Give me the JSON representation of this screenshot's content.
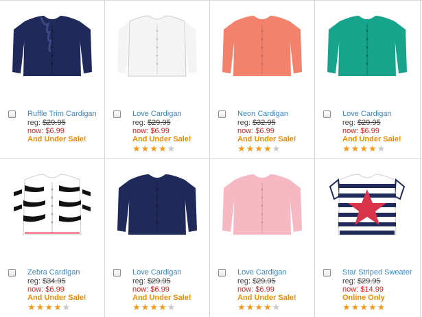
{
  "products": [
    {
      "name": "Ruffle Trim Cardigan",
      "reg_label": "reg:",
      "reg_price": "$29.95",
      "now_label": "now:",
      "now_price": "$6.99",
      "promo": "And Under Sale!",
      "rating": 0,
      "color": "#1f2a5a",
      "style": "ruffle"
    },
    {
      "name": "Love Cardigan",
      "reg_label": "reg:",
      "reg_price": "$29.95",
      "now_label": "now:",
      "now_price": "$6.99",
      "promo": "And Under Sale!",
      "rating": 4,
      "color": "#f4f4f4",
      "style": "plain"
    },
    {
      "name": "Neon Cardigan",
      "reg_label": "reg:",
      "reg_price": "$32.95",
      "now_label": "now:",
      "now_price": "$6.99",
      "promo": "And Under Sale!",
      "rating": 4,
      "color": "#f3826d",
      "style": "plain"
    },
    {
      "name": "Love Cardigan",
      "reg_label": "reg:",
      "reg_price": "$29.95",
      "now_label": "now:",
      "now_price": "$6.99",
      "promo": "And Under Sale!",
      "rating": 4,
      "color": "#17a48c",
      "style": "plain"
    },
    {
      "name": "Zebra Cardigan",
      "reg_label": "reg:",
      "reg_price": "$34.95",
      "now_label": "now:",
      "now_price": "$6.99",
      "promo": "And Under Sale!",
      "rating": 4.5,
      "color": "#111111",
      "style": "zebra"
    },
    {
      "name": "Love Cardigan",
      "reg_label": "reg:",
      "reg_price": "$29.95",
      "now_label": "now:",
      "now_price": "$6.99",
      "promo": "And Under Sale!",
      "rating": 4,
      "color": "#1f2a5a",
      "style": "plain"
    },
    {
      "name": "Love Cardigan",
      "reg_label": "reg:",
      "reg_price": "$29.95",
      "now_label": "now:",
      "now_price": "$6.99",
      "promo": "And Under Sale!",
      "rating": 4,
      "color": "#f6b8c2",
      "style": "plain"
    },
    {
      "name": "Star Striped Sweater",
      "reg_label": "reg:",
      "reg_price": "$29.95",
      "now_label": "now:",
      "now_price": "$14.99",
      "promo": "Online Only",
      "rating": 5,
      "color": "#1f2a5a",
      "style": "stripe"
    }
  ]
}
